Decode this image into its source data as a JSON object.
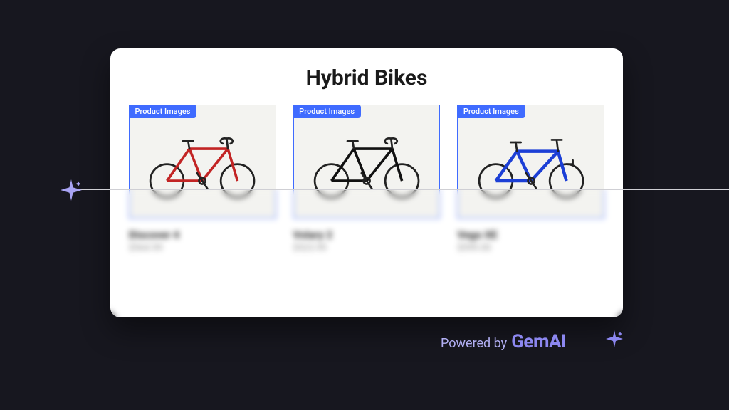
{
  "page": {
    "title": "Hybrid Bikes"
  },
  "overlay": {
    "badge_label": "Product Images"
  },
  "products": [
    {
      "name": "Discover 4",
      "price": "$564.99",
      "frame_color": "#c22424"
    },
    {
      "name": "Volary 2",
      "price": "$523.99",
      "frame_color": "#111111"
    },
    {
      "name": "Vego XE",
      "price": "$599.00",
      "frame_color": "#1c3fd6"
    }
  ],
  "branding": {
    "prefix": "Powered by",
    "name": "GemAI"
  },
  "theme": {
    "accent": "#3f6bff",
    "brand_purple": "#8c87f0"
  }
}
